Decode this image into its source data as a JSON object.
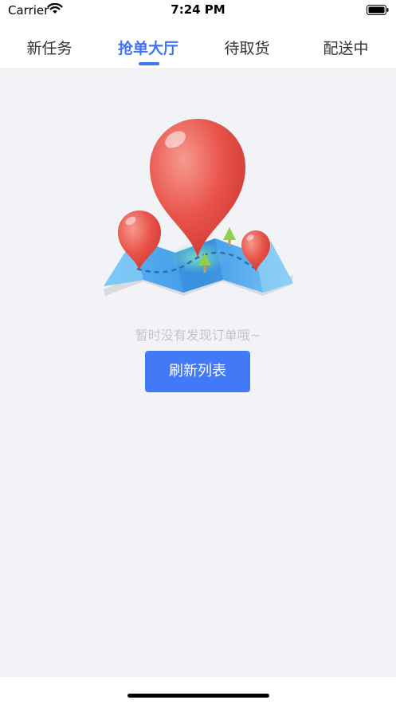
{
  "status_bar": {
    "carrier": "Carrier",
    "time": "7:24 PM",
    "icons": [
      "wifi-icon",
      "battery-icon"
    ]
  },
  "tabs": [
    {
      "label": "新任务",
      "active": false
    },
    {
      "label": "抢单大厅",
      "active": true
    },
    {
      "label": "待取货",
      "active": false
    },
    {
      "label": "配送中",
      "active": false
    }
  ],
  "empty_state": {
    "illustration": "map-with-location-pins",
    "message": "暂时没有发现订单哦~",
    "refresh_button": "刷新列表"
  },
  "colors": {
    "accent": "#3d73f5",
    "button": "#4279f7",
    "background": "#f2f3f6",
    "empty_text": "#c2c5cc"
  }
}
